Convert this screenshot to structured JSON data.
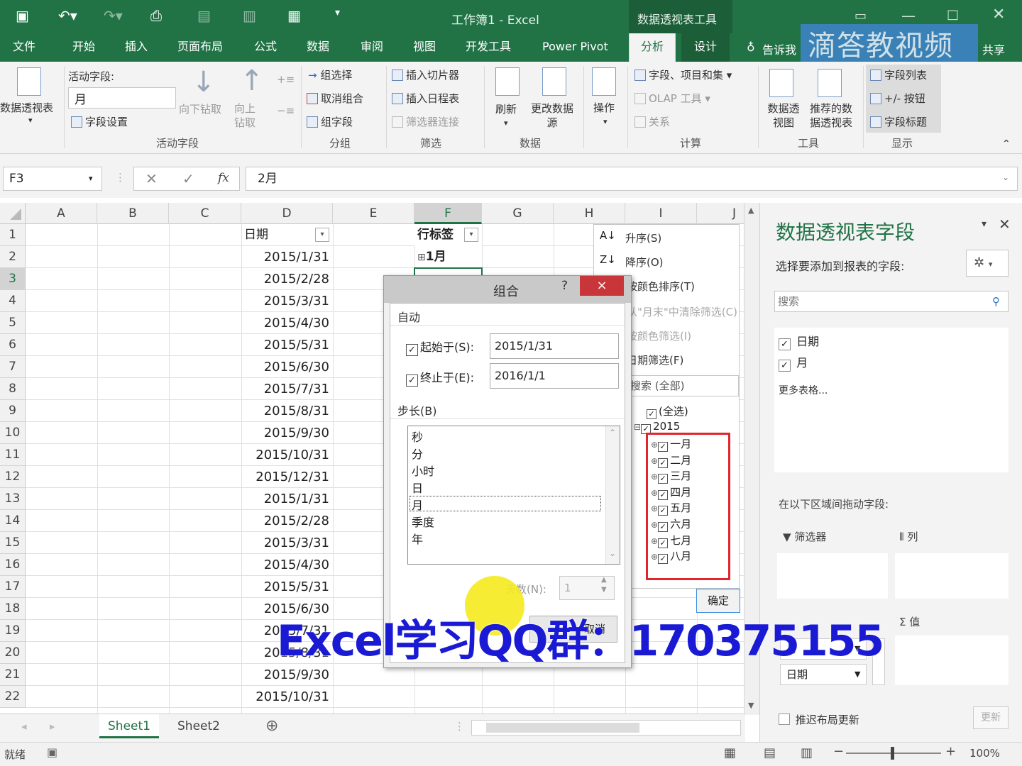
{
  "window": {
    "title": "工作簿1 - Excel",
    "context_group": "数据透视表工具"
  },
  "tabs": [
    "文件",
    "开始",
    "插入",
    "页面布局",
    "公式",
    "数据",
    "审阅",
    "视图",
    "开发工具",
    "Power Pivot",
    "分析",
    "设计"
  ],
  "tell_me": "告诉我",
  "share": "共享",
  "watermark": "滴答教视频",
  "ribbon": {
    "pivot_btn": "数据透视表",
    "active_field_label": "活动字段:",
    "active_field_value": "月",
    "field_settings": "字段设置",
    "drill_down": "向下钻取",
    "drill_up": "向上钻取",
    "group_active": "活动字段",
    "group_selection": "组选择",
    "ungroup": "取消组合",
    "group_field": "组字段",
    "group_group": "分组",
    "insert_slicer": "插入切片器",
    "insert_timeline": "插入日程表",
    "filter_conn": "筛选器连接",
    "group_filter": "筛选",
    "refresh": "刷新",
    "change_source": "更改数据源",
    "group_data": "数据",
    "actions": "操作",
    "fields_items": "字段、项目和集",
    "olap": "OLAP 工具",
    "relations": "关系",
    "group_calc": "计算",
    "pivot_chart": "数据透视图",
    "recommended": "推荐的数据透视表",
    "group_tools": "工具",
    "field_list": "字段列表",
    "plus_minus": "+/- 按钮",
    "field_headers": "字段标题",
    "group_show": "显示"
  },
  "formula": {
    "namebox": "F3",
    "value": "2月",
    "fx": "fx"
  },
  "columns": [
    "A",
    "B",
    "C",
    "D",
    "E",
    "F",
    "G",
    "H",
    "I",
    "J"
  ],
  "rows": [
    "1",
    "2",
    "3",
    "4",
    "5",
    "6",
    "7",
    "8",
    "9",
    "10",
    "11",
    "12",
    "13",
    "14",
    "15",
    "16",
    "17",
    "18",
    "19",
    "20",
    "21",
    "22"
  ],
  "header_date": "日期",
  "header_rowlabel": "行标签",
  "pivot_first": "1月",
  "dates": [
    "2015/1/31",
    "2015/2/28",
    "2015/3/31",
    "2015/4/30",
    "2015/5/31",
    "2015/6/30",
    "2015/7/31",
    "2015/8/31",
    "2015/9/30",
    "2015/10/31",
    "2015/12/31",
    "2015/1/31",
    "2015/2/28",
    "2015/3/31",
    "2015/4/30",
    "2015/5/31",
    "2015/6/30",
    "2015/7/31",
    "2015/8/31",
    "2015/9/30",
    "2015/10/31"
  ],
  "sortmenu": {
    "asc": "升序(S)",
    "desc": "降序(O)",
    "by_color": "按颜色排序(T)",
    "clear": "从\"月末\"中清除筛选(C)",
    "color_filter": "按颜色筛选(I)",
    "date_filter": "日期筛选(F)",
    "search": "搜索 (全部)",
    "select_all": "(全选)",
    "year": "2015",
    "months": [
      "一月",
      "二月",
      "三月",
      "四月",
      "五月",
      "六月",
      "七月",
      "八月"
    ],
    "ok": "确定"
  },
  "dialog": {
    "title": "组合",
    "help": "?",
    "close": "×",
    "auto": "自动",
    "start_label": "起始于(S):",
    "start_value": "2015/1/31",
    "end_label": "终止于(E):",
    "end_value": "2016/1/1",
    "step_label": "步长(B)",
    "steps": [
      "秒",
      "分",
      "小时",
      "日",
      "月",
      "季度",
      "年"
    ],
    "days_label": "天数(N):",
    "days_value": "1",
    "cancel": "取消"
  },
  "overlay": "Excel学习QQ群：170375155",
  "pane": {
    "title": "数据透视表字段",
    "subtitle": "选择要添加到报表的字段:",
    "search_placeholder": "搜索",
    "fields": [
      "日期",
      "月"
    ],
    "more": "更多表格...",
    "drag_label": "在以下区域间拖动字段:",
    "filters": "筛选器",
    "columns": "列",
    "rows_items": [
      "月",
      "日期"
    ],
    "values": "值",
    "defer": "推迟布局更新",
    "update": "更新"
  },
  "sheets": [
    "Sheet1",
    "Sheet2"
  ],
  "status": {
    "ready": "就绪",
    "zoom": "100%"
  }
}
